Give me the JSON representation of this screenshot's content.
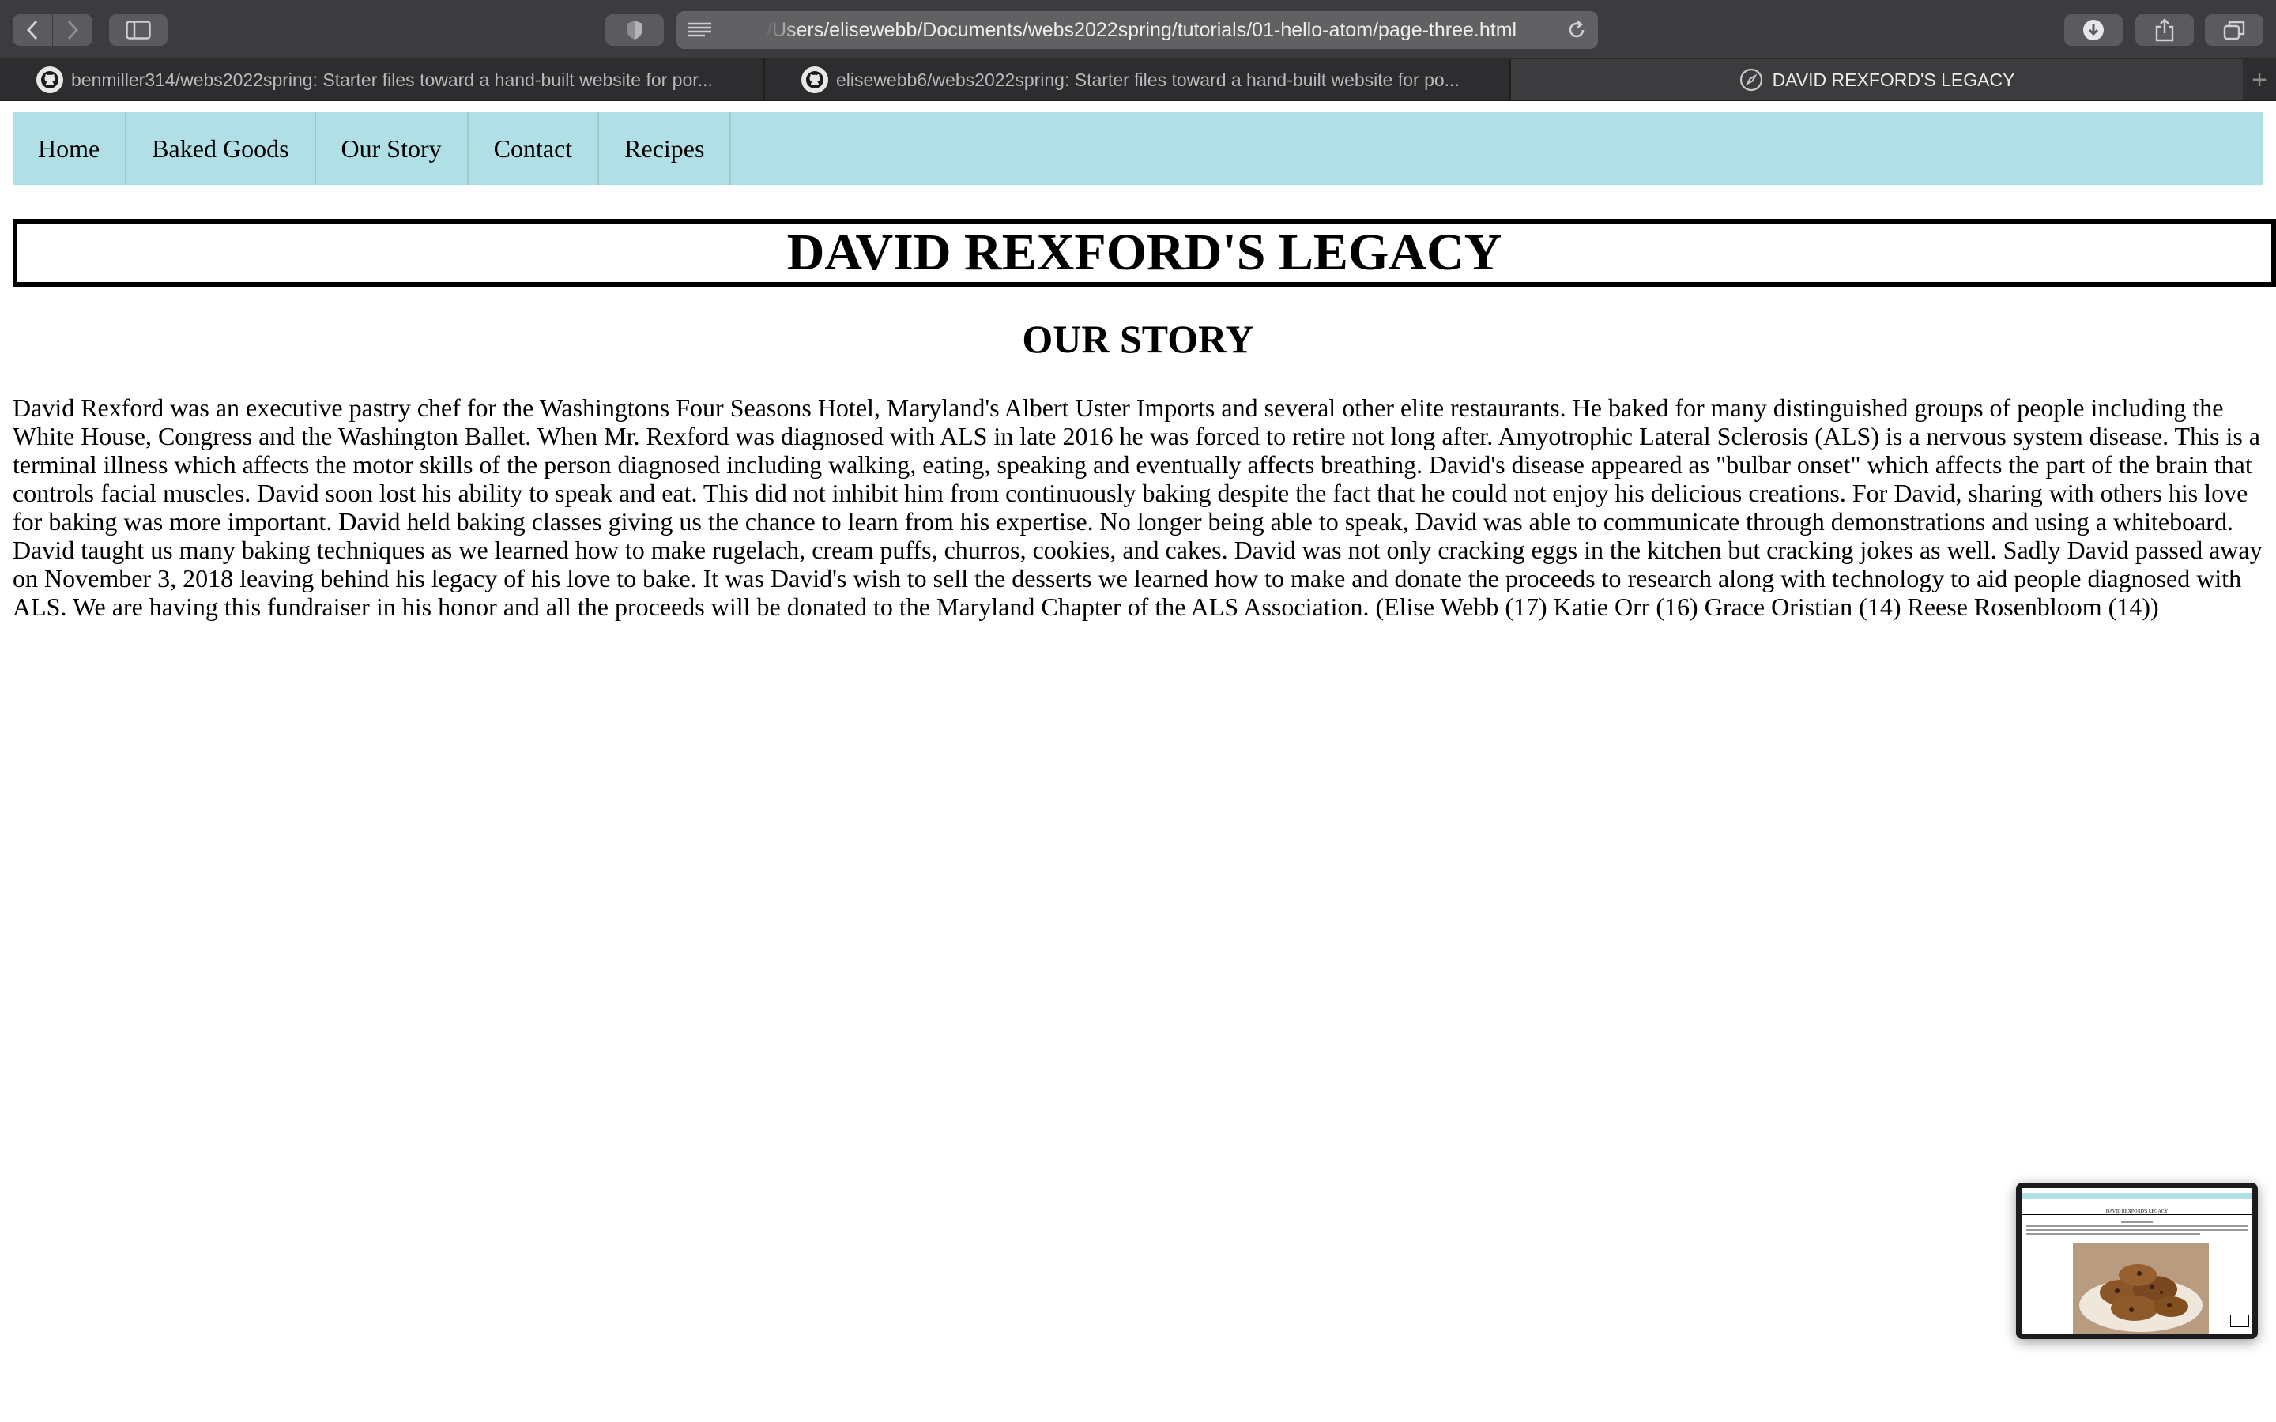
{
  "browser": {
    "url": "/Users/elisewebb/Documents/webs2022spring/tutorials/01-hello-atom/page-three.html",
    "tabs": [
      {
        "label": "benmiller314/webs2022spring: Starter files toward a hand-built website for por...",
        "icon": "github-icon",
        "active": false
      },
      {
        "label": "elisewebb6/webs2022spring: Starter files toward a hand-built website for po...",
        "icon": "github-icon",
        "active": false
      },
      {
        "label": "DAVID REXFORD'S LEGACY",
        "icon": "compass-icon",
        "active": true
      }
    ],
    "new_tab": "+"
  },
  "site": {
    "nav": [
      "Home",
      "Baked Goods",
      "Our Story",
      "Contact",
      "Recipes"
    ],
    "title": "DAVID REXFORD'S LEGACY",
    "section_title": "OUR STORY",
    "story": "David Rexford was an executive pastry chef for the Washingtons Four Seasons Hotel, Maryland's Albert Uster Imports and several other elite restaurants. He baked for many distinguished groups of people including the White House, Congress and the Washington Ballet. When Mr. Rexford was diagnosed with ALS in late 2016 he was forced to retire not long after. Amyotrophic Lateral Sclerosis (ALS) is a nervous system disease. This is a terminal illness which affects the motor skills of the person diagnosed including walking, eating, speaking and eventually affects breathing. David's disease appeared as \"bulbar onset\" which affects the part of the brain that controls facial muscles. David soon lost his ability to speak and eat. This did not inhibit him from continuously baking despite the fact that he could not enjoy his delicious creations. For David, sharing with others his love for baking was more important. David held baking classes giving us the chance to learn from his expertise. No longer being able to speak, David was able to communicate through demonstrations and using a whiteboard. David taught us many baking techniques as we learned how to make rugelach, cream puffs, churros, cookies, and cakes. David was not only cracking eggs in the kitchen but cracking jokes as well. Sadly David passed away on November 3, 2018 leaving behind his legacy of his love to bake. It was David's wish to sell the desserts we learned how to make and donate the proceeds to research along with technology to aid people diagnosed with ALS. We are having this fundraiser in his honor and all the proceeds will be donated to the Maryland Chapter of the ALS Association. (Elise Webb (17) Katie Orr (16) Grace Oristian (14) Reese Rosenbloom (14))"
  },
  "preview": {
    "title": "DAVID REXFORD'S LEGACY"
  },
  "colors": {
    "nav_background": "#b0dfe5",
    "toolbar": "#3c3c3e",
    "tabbar": "#2d2d2f"
  }
}
